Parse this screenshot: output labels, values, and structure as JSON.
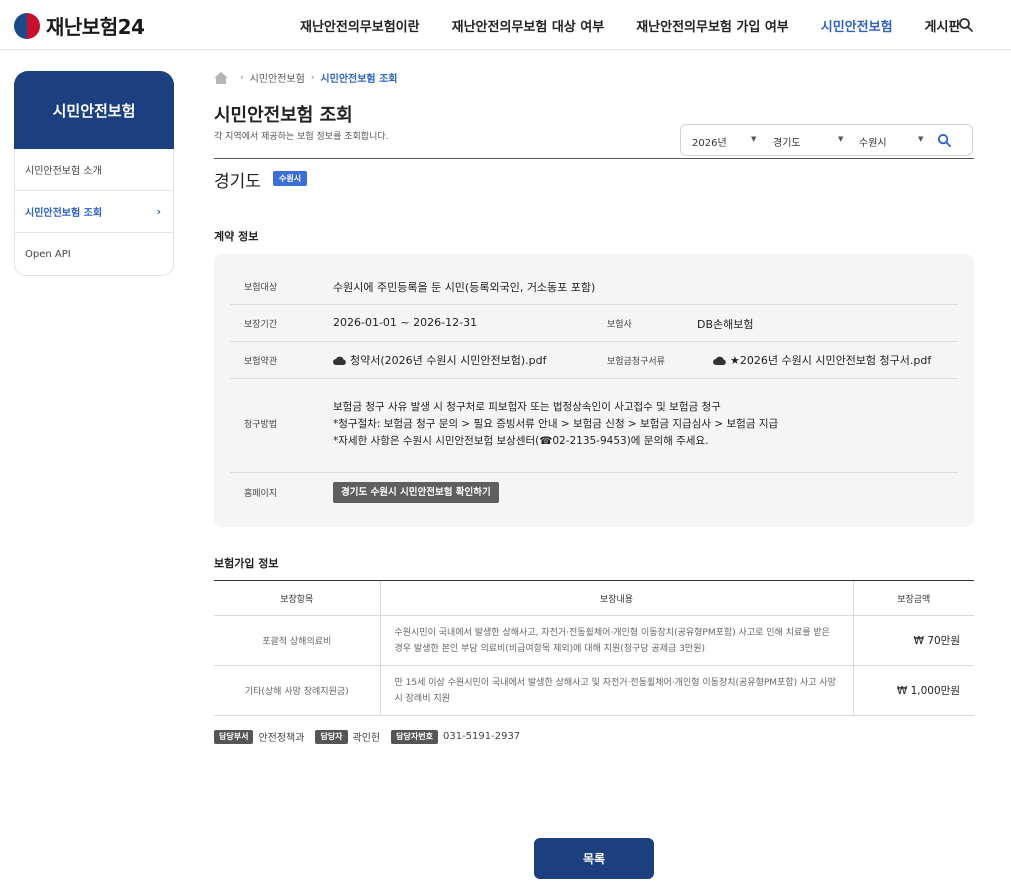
{
  "header": {
    "logo_text": "재난보험24",
    "nav": [
      "재난안전의무보험이란",
      "재난안전의무보험 대상 여부",
      "재난안전의무보험 가입 여부",
      "시민안전보험",
      "게시판"
    ],
    "active_index": 3
  },
  "sidebar": {
    "title": "시민안전보험",
    "items": [
      {
        "label": "시민안전보험 소개"
      },
      {
        "label": "시민안전보험 조회"
      },
      {
        "label": "Open API"
      }
    ]
  },
  "breadcrumb": [
    "시민안전보험",
    "시민안전보험 조회"
  ],
  "page": {
    "title": "시민안전보험 조회",
    "description": "각 지역에서 제공하는 보험 정보를 조회합니다."
  },
  "filter": {
    "year": "2026년",
    "province": "경기도",
    "city": "수원시"
  },
  "region": {
    "name": "경기도",
    "badge": "수원시"
  },
  "contract": {
    "section_title": "계약 정보",
    "target_label": "보험대상",
    "target_value": "수원시에 주민등록을 둔 시민(등록외국인, 거소동포 포함)",
    "period_label": "보장기간",
    "period_value": "2026-01-01 ~ 2026-12-31",
    "insurer_label": "보험사",
    "insurer_value": "DB손해보험",
    "terms_label": "보험약관",
    "terms_file": "청약서(2026년 수원시 시민안전보험).pdf",
    "claimdoc_label": "보험금청구서류",
    "claimdoc_file": "★2026년 수원시 시민안전보험 청구서.pdf",
    "claim_label": "청구방법",
    "claim_lines": [
      "보험금 청구 사유 발생 시 청구처로 피보험자 또는 법정상속인이 사고접수 및 보험금 청구",
      "*청구절차: 보험금 청구 문의 > 필요 증빙서류 안내 > 보험금 신청 > 보험금 지급심사 > 보험금 지급",
      "*자세한 사항은 수원시 시민안전보험 보상센터(☎02-2135-9453)에 문의해 주세요."
    ],
    "homepage_label": "홈페이지",
    "homepage_button": "경기도 수원시 시민안전보험 확인하기"
  },
  "coverage": {
    "section_title": "보험가입 정보",
    "headers": [
      "보장항목",
      "보장내용",
      "보장금액"
    ],
    "rows": [
      {
        "item": "포괄적 상해의료비",
        "desc": "수원시민이 국내에서 발생한 상해사고, 자전거·전동휠체어·개인형 이동장치(공유형PM포함) 사고로 인해 치료를 받은 경우 발생한 본인 부담 의료비(비급여항목 제외)에 대해 지원(청구당 공제금 3만원)",
        "amount": "₩  70만원"
      },
      {
        "item": "기타(상해 사망 장례지원금)",
        "desc": "만 15세 이상 수원시민이 국내에서 발생한 상해사고 및 자전거·전동휠체어·개인형 이동장치(공유형PM포함) 사고 사망 시 장례비 지원",
        "amount": "₩  1,000만원"
      }
    ]
  },
  "contact": {
    "dept_badge": "담당부서",
    "dept": "안전정책과",
    "person_badge": "담당자",
    "person": "곽인헌",
    "phone_badge": "담당자번호",
    "phone": "031-5191-2937"
  },
  "list_button": "목록"
}
